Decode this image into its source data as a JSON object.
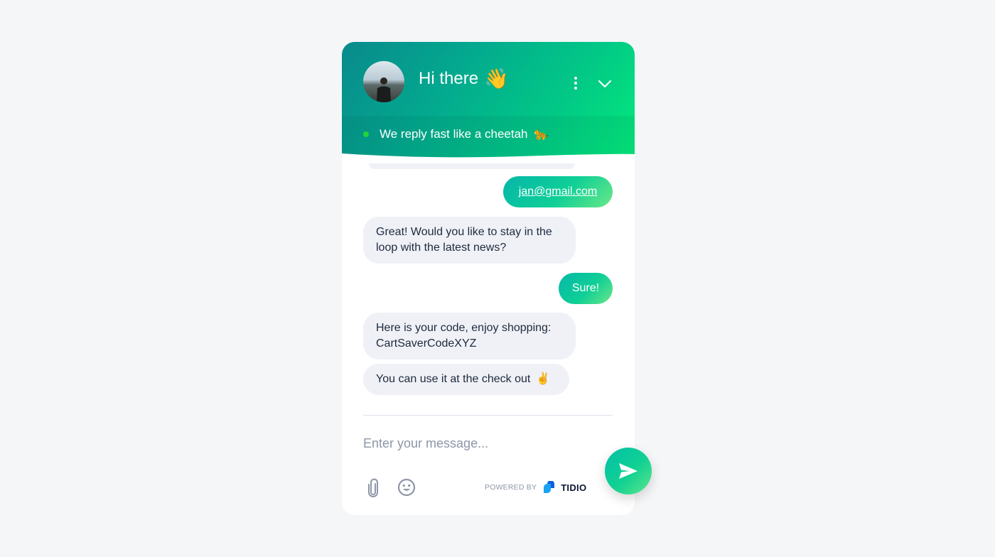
{
  "header": {
    "title": "Hi there",
    "title_emoji": "👋",
    "status_text": "We reply fast like a cheetah",
    "status_emoji": "🐆",
    "status": "online",
    "menu_icon": "more-vertical-icon",
    "collapse_icon": "chevron-down-icon",
    "gradient_colors": [
      "#098a8c",
      "#04ea7c"
    ]
  },
  "messages": [
    {
      "sender": "visitor",
      "text": "jan@gmail.com",
      "is_link": true
    },
    {
      "sender": "operator",
      "lines": [
        "Great! Would you like to stay in the",
        "loop with the latest news?"
      ]
    },
    {
      "sender": "visitor",
      "text": "Sure!"
    },
    {
      "sender": "operator",
      "lines": [
        "Here is your code, enjoy shopping:",
        "CartSaverCodeXYZ"
      ]
    },
    {
      "sender": "operator",
      "text": "You can use it at the check out",
      "emoji": "✌️"
    }
  ],
  "composer": {
    "placeholder": "Enter your message...",
    "value": "",
    "attach_icon": "paperclip-icon",
    "emoji_icon": "smiley-icon",
    "send_icon": "send-icon"
  },
  "footer": {
    "powered_by": "POWERED BY",
    "brand": "TIDIO"
  },
  "colors": {
    "accent": "#0fcf96",
    "operator_bubble": "#eff1f7",
    "online_dot": "#1fd53a",
    "page_background": "#f4f6f8"
  }
}
